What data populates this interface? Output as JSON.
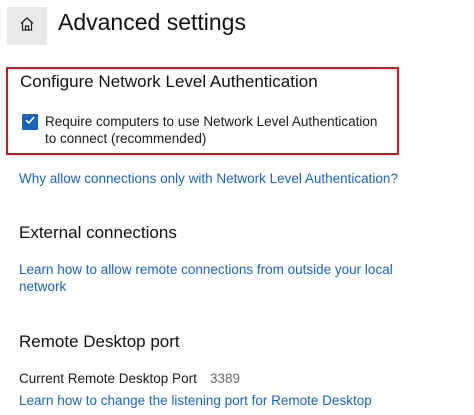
{
  "header": {
    "home_icon": "home-icon",
    "title": "Advanced settings"
  },
  "nla": {
    "title": "Configure Network Level Authentication",
    "checkbox_checked": true,
    "checkbox_label": "Require computers to use Network Level Authentication to connect (recommended)",
    "help_link": "Why allow connections only with Network Level Authentication?",
    "highlight_color": "#d0161e"
  },
  "external": {
    "title": "External connections",
    "help_link": "Learn how to allow remote connections from outside your local network"
  },
  "rdp_port": {
    "title": "Remote Desktop port",
    "port_label": "Current Remote Desktop Port",
    "port_value": "3389",
    "help_link": "Learn how to change the listening port for Remote Desktop"
  },
  "colors": {
    "accent": "#1a63b8",
    "highlight": "#d0161e"
  }
}
